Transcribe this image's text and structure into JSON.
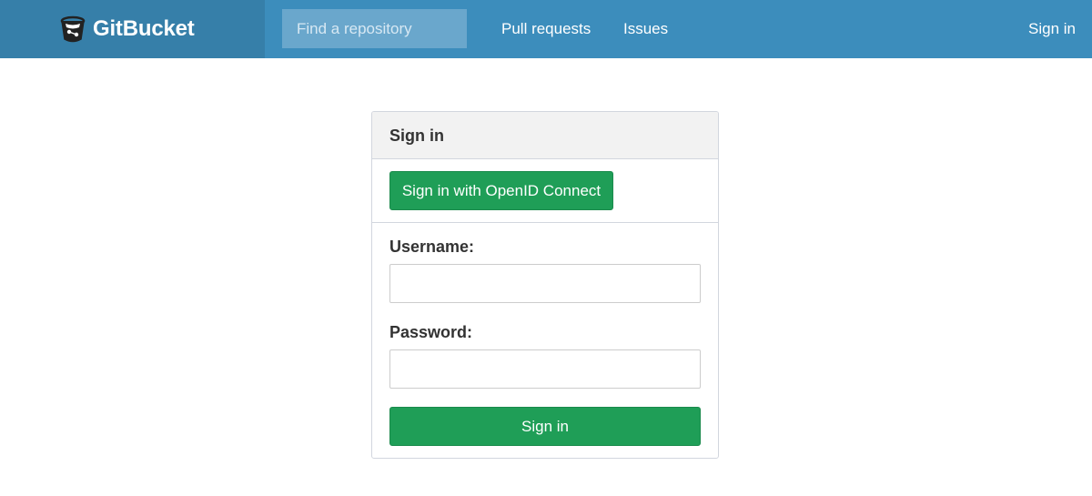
{
  "header": {
    "brand": "GitBucket",
    "brand_icon": "gitbucket-logo-icon",
    "search_placeholder": "Find a repository",
    "nav": {
      "pull_requests": "Pull requests",
      "issues": "Issues",
      "sign_in": "Sign in"
    }
  },
  "signin_panel": {
    "title": "Sign in",
    "openid_button": "Sign in with OpenID Connect",
    "username_label": "Username:",
    "username_value": "",
    "password_label": "Password:",
    "password_value": "",
    "submit_button": "Sign in"
  },
  "colors": {
    "navbar": "#3c8dbc",
    "brand_area": "#367fa9",
    "search_bg": "#6aa7cc",
    "button_green": "#1f9e57",
    "panel_heading_bg": "#f2f2f2",
    "border": "#d2d6de"
  }
}
